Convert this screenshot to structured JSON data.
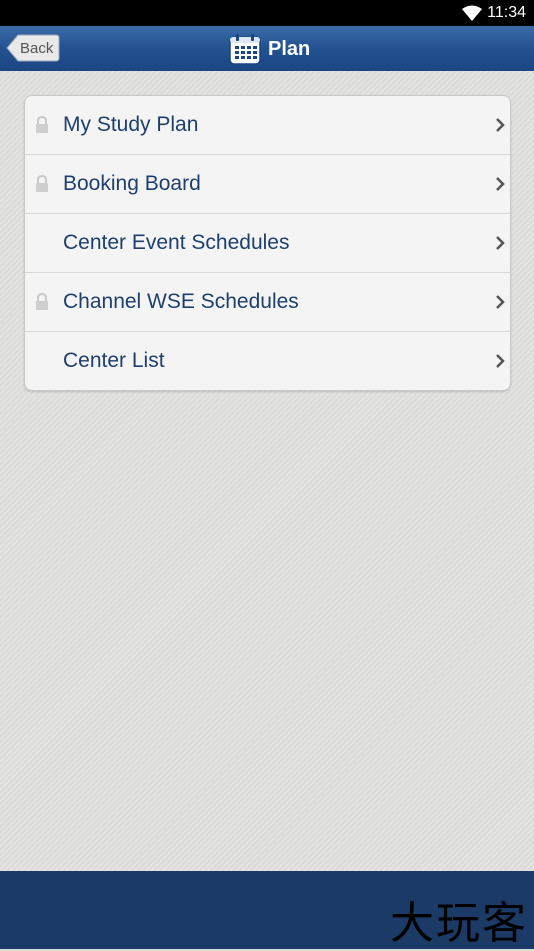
{
  "status_bar": {
    "time": "11:34"
  },
  "nav": {
    "back_label": "Back",
    "title": "Plan",
    "title_icon": "calendar-icon"
  },
  "menu": {
    "items": [
      {
        "label": "My Study Plan",
        "locked": true
      },
      {
        "label": "Booking Board",
        "locked": true
      },
      {
        "label": "Center Event Schedules",
        "locked": false
      },
      {
        "label": "Channel WSE Schedules",
        "locked": true
      },
      {
        "label": "Center List",
        "locked": false
      }
    ]
  },
  "watermark": {
    "text": "大玩客"
  },
  "colors": {
    "nav_bar": "#245291",
    "label_text": "#1d3f6e",
    "bottom_bar": "#1c3a66"
  }
}
